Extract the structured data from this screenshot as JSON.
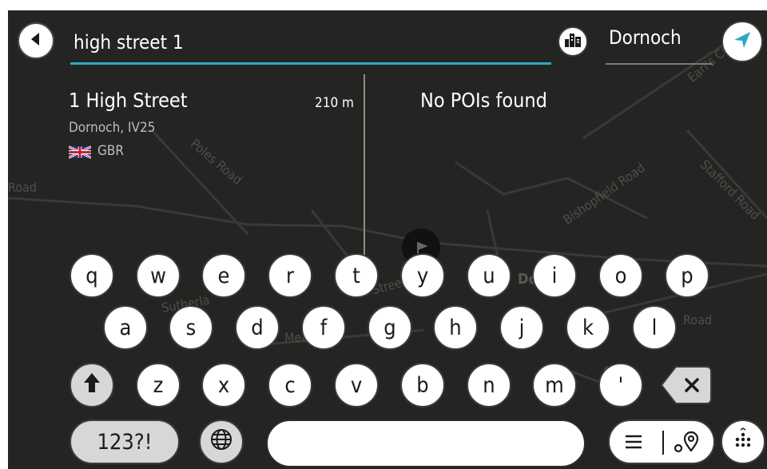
{
  "header": {
    "back_icon": "arrow-left-icon",
    "search_value": "high street 1",
    "city_icon": "city-buildings-icon",
    "city_name": "Dornoch",
    "nav_icon": "navigation-arrow-icon"
  },
  "results": {
    "address": {
      "title": "1 High Street",
      "distance": "210 m",
      "locality": "Dornoch, IV25",
      "country": "GBR",
      "flag_icon": "uk-flag-icon"
    },
    "poi_message": "No POIs found"
  },
  "map_labels": [
    "Poles Road",
    "Bishopfield Road",
    "Stafford Road",
    "Earl's Cro",
    "Road",
    "Sutherla",
    "Street",
    "Dorn",
    "Road",
    "Gol",
    "Mea"
  ],
  "keyboard": {
    "row1": [
      "q",
      "w",
      "e",
      "r",
      "t",
      "y",
      "u",
      "i",
      "o",
      "p"
    ],
    "row2": [
      "a",
      "s",
      "d",
      "f",
      "g",
      "h",
      "j",
      "k",
      "l"
    ],
    "row3": [
      "z",
      "x",
      "c",
      "v",
      "b",
      "n",
      "m",
      "'"
    ],
    "shift_icon": "shift-arrow-icon",
    "backspace_icon": "backspace-icon",
    "numbers_label": "123?!",
    "language_icon": "globe-icon",
    "space_value": "",
    "list_icon": "list-icon",
    "map_pin_icon": "map-pin-icon",
    "more_icon": "more-dots-icon"
  },
  "colors": {
    "accent": "#2aa9c5",
    "background": "#242423"
  }
}
